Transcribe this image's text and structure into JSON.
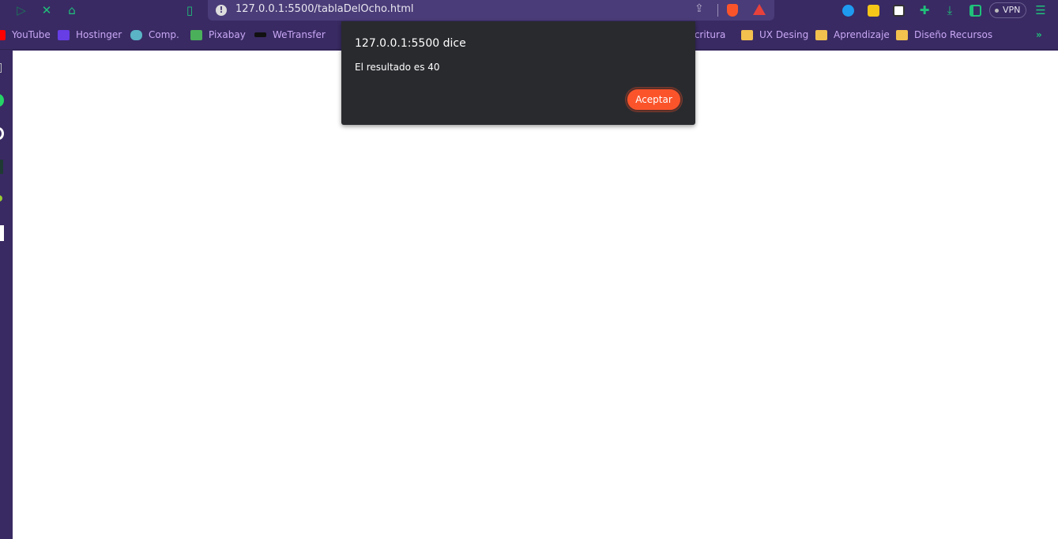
{
  "browser": {
    "url": "127.0.0.1:5500/tablaDelOcho.html",
    "vpn_label": "VPN",
    "accent": "#20c07a",
    "nav_icons": [
      "play-icon",
      "stop-x-icon",
      "home-icon",
      "bookmark-icon"
    ]
  },
  "bookmarks": [
    {
      "label": "YouTube",
      "icon": "youtube-icon",
      "color": "#ff0000"
    },
    {
      "label": "Hostinger",
      "icon": "hostinger-icon",
      "color": "#673de6"
    },
    {
      "label": "Comp.",
      "icon": "crocodile-icon",
      "color": "#5ab4c5"
    },
    {
      "label": "Pixabay",
      "icon": "pixabay-icon",
      "color": "#4bb05a"
    },
    {
      "label": "WeTransfer",
      "icon": "wetransfer-icon",
      "color": "#111111"
    },
    {
      "label": "Escritura",
      "icon": "folder-icon",
      "color": "#f2c14e"
    },
    {
      "label": "UX Desing",
      "icon": "folder-icon",
      "color": "#f2c14e"
    },
    {
      "label": "Aprendizaje",
      "icon": "folder-icon",
      "color": "#f2c14e"
    },
    {
      "label": "Diseño Recursos",
      "icon": "folder-icon",
      "color": "#f2c14e"
    }
  ],
  "dialog": {
    "title": "127.0.0.1:5500 dice",
    "message": "El resultado es 40",
    "ok_label": "Aceptar",
    "button_color": "#fb542b"
  }
}
